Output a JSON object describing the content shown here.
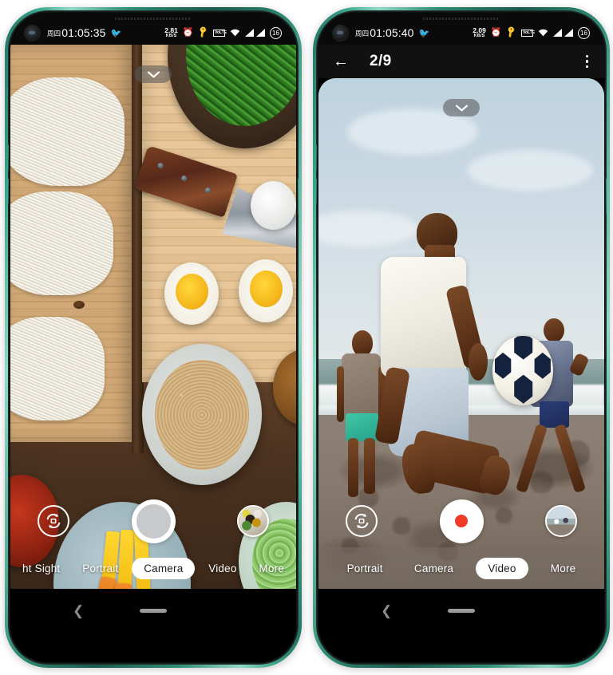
{
  "app": {
    "name": "Camera"
  },
  "phones": [
    {
      "id": "left",
      "status_bar": {
        "day_of_week": "周四",
        "clock": "01:05:35",
        "notification_icon": "bird-emoji",
        "net_speed_value": "2.81",
        "net_speed_unit": "KB/S",
        "icons": [
          "alarm-icon",
          "key-icon",
          "volte-icon",
          "wifi-icon",
          "signal-icon",
          "signal-icon"
        ],
        "volte_label": "VoLTE",
        "battery_level": "16"
      },
      "toolbar": null,
      "viewfinder": {
        "scene": "overhead-flatlay-of-fresh-noodles-knife-eggs-and-side-dishes-on-wooden-board",
        "expand_chevron": "chevron-down-icon"
      },
      "controls": {
        "flip_icon": "camera-flip-icon",
        "shutter_type": "photo",
        "thumbnail": "last-photo-food-bowls"
      },
      "modes": [
        {
          "label": "ht Sight",
          "active": false
        },
        {
          "label": "Portrait",
          "active": false
        },
        {
          "label": "Camera",
          "active": true
        },
        {
          "label": "Video",
          "active": false
        },
        {
          "label": "More",
          "active": false
        }
      ],
      "nav_bar": {
        "back_icon": "back-chevron-icon",
        "home_icon": "home-pill-icon"
      }
    },
    {
      "id": "right",
      "status_bar": {
        "day_of_week": "周四",
        "clock": "01:05:40",
        "notification_icon": "bird-emoji",
        "net_speed_value": "2.09",
        "net_speed_unit": "KB/S",
        "icons": [
          "alarm-icon",
          "key-icon",
          "volte-icon",
          "wifi-icon",
          "signal-icon",
          "signal-icon"
        ],
        "volte_label": "VoLTE",
        "battery_level": "16"
      },
      "toolbar": {
        "back_icon": "arrow-left-icon",
        "title": "2/9",
        "menu_icon": "overflow-menu-icon"
      },
      "viewfinder": {
        "scene": "men-playing-football-on-a-sandy-beach-by-the-sea",
        "expand_chevron": "chevron-down-icon"
      },
      "controls": {
        "flip_icon": "camera-flip-icon",
        "shutter_type": "video",
        "record_dot_color": "#ef3b28",
        "thumbnail": "last-photo-beach-players"
      },
      "modes": [
        {
          "label": "Portrait",
          "active": false
        },
        {
          "label": "Camera",
          "active": false
        },
        {
          "label": "Video",
          "active": true
        },
        {
          "label": "More",
          "active": false
        }
      ],
      "nav_bar": {
        "back_icon": "back-chevron-icon",
        "home_icon": "home-pill-icon"
      }
    }
  ],
  "colors": {
    "frame": "#2f8b74",
    "record_red": "#ef3b28",
    "mode_active_bg": "#ffffff",
    "status_text": "#ffffff"
  }
}
